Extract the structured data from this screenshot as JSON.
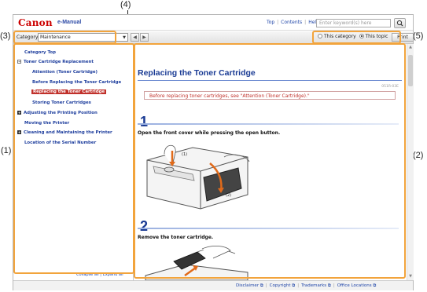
{
  "callouts": {
    "c1": "(1)",
    "c2": "(2)",
    "c3": "(3)",
    "c4": "(4)",
    "c5": "(5)"
  },
  "header": {
    "logo": "Canon",
    "product": "e-Manual",
    "links": [
      "Top",
      "Contents",
      "Help"
    ],
    "search_placeholder": "Enter keyword(s) here"
  },
  "catbar": {
    "label": "Category:",
    "selected": "Maintenance",
    "scope_category": "This category",
    "scope_topic": "This topic",
    "print": "Print"
  },
  "sidebar": {
    "items": [
      {
        "label": "Category Top"
      },
      {
        "label": "Toner Cartridge Replacement"
      },
      {
        "label": "Attention (Toner Cartridge)"
      },
      {
        "label": "Before Replacing the Toner Cartridge"
      },
      {
        "label": "Replacing the Toner Cartridge"
      },
      {
        "label": "Storing Toner Cartridges"
      },
      {
        "label": "Adjusting the Printing Position"
      },
      {
        "label": "Moving the Printer"
      },
      {
        "label": "Cleaning and Maintaining the Printer"
      },
      {
        "label": "Location of the Serial Number"
      }
    ],
    "collapse_all": "Collapse all",
    "expand_all": "Expand all"
  },
  "content": {
    "title": "Replacing the Toner Cartridge",
    "doc_id": "051R-03E",
    "notice": "Before replacing toner cartridges, see \"Attention (Toner Cartridge).\"",
    "steps": [
      {
        "number": "1",
        "text": "Open the front cover while pressing the open button.",
        "labels": [
          "(1)",
          "(2)"
        ]
      },
      {
        "number": "2",
        "text": "Remove the toner cartridge."
      }
    ]
  },
  "footer": {
    "links": [
      "Disclaimer",
      "Copyright",
      "Trademarks",
      "Office Locations"
    ]
  },
  "colors": {
    "highlight": "#f2a43c",
    "brand": "#cc0000",
    "link": "#1f3f9e"
  }
}
